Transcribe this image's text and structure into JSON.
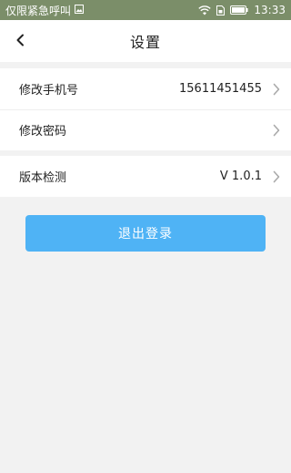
{
  "status_bar": {
    "carrier_text": "仅限紧急呼叫",
    "time": "13:33",
    "icons": [
      "image-icon",
      "wifi-icon",
      "sim-icon",
      "battery-icon"
    ]
  },
  "header": {
    "title": "设置",
    "back_icon": "chevron-left-icon"
  },
  "settings": {
    "rows": [
      {
        "label": "修改手机号",
        "value": "15611451455"
      },
      {
        "label": "修改密码",
        "value": ""
      },
      {
        "label": "版本检测",
        "value": "V 1.0.1"
      }
    ]
  },
  "logout": {
    "label": "退出登录"
  },
  "colors": {
    "status_bar_bg": "#7b8e69",
    "page_bg": "#f2f2f2",
    "button_bg": "#4fb3f5",
    "chevron": "#aaaaaa"
  }
}
